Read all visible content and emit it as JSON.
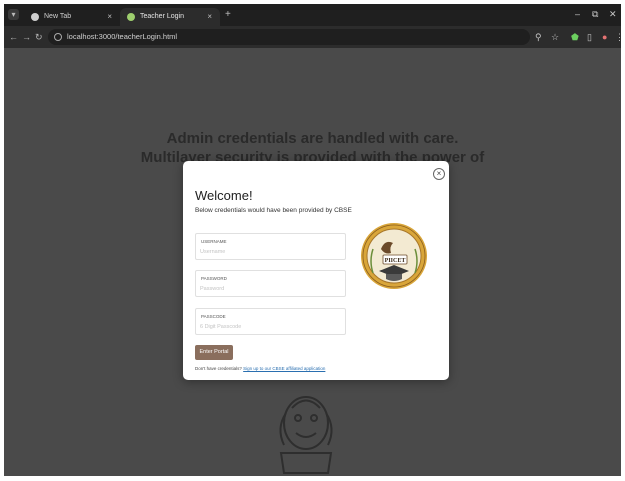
{
  "browser": {
    "tabs": [
      {
        "title": "New Tab",
        "close": "×"
      },
      {
        "title": "Teacher Login",
        "close": "×"
      }
    ],
    "new_tab_glyph": "+",
    "window_controls": {
      "minimize": "–",
      "maximize": "⧉",
      "close": "✕"
    },
    "nav": {
      "back": "←",
      "forward": "→",
      "reload": "↻"
    },
    "url": "localhost:3000/teacherLogin.html",
    "toolbar_icons": [
      "zoom-icon",
      "star-icon",
      "extension-shield-icon",
      "sidebar-icon",
      "profile-icon",
      "menu-icon"
    ],
    "toolbar_glyphs": {
      "zoom": "⚲",
      "star": "☆",
      "shield": "⬟",
      "sidebar": "▯",
      "profile": "●",
      "menu": "⋮"
    }
  },
  "background": {
    "line1": "Admin credentials are handled with care.",
    "line2": "Multilayer security is provided with the power of"
  },
  "modal": {
    "close_glyph": "×",
    "title": "Welcome!",
    "subtitle": "Below credentials would have been provided by CBSE",
    "fields": [
      {
        "label": "USERNAME",
        "placeholder": "Username"
      },
      {
        "label": "PASSWORD",
        "placeholder": "Password"
      },
      {
        "label": "PASSCODE",
        "placeholder": "6 Digit Passcode"
      }
    ],
    "submit_label": "Enter Portal",
    "signup_prompt": "Don't have credentials?",
    "signup_link": "Sign up to our CBSE affiliated application",
    "logo_text": {
      "ring": "COLLEGE OF ENGINEERING",
      "name": "PIICET"
    }
  },
  "colors": {
    "overlay": "#4a4a4a",
    "button": "#8a6e5d",
    "logo_gold": "#d9a63a"
  }
}
